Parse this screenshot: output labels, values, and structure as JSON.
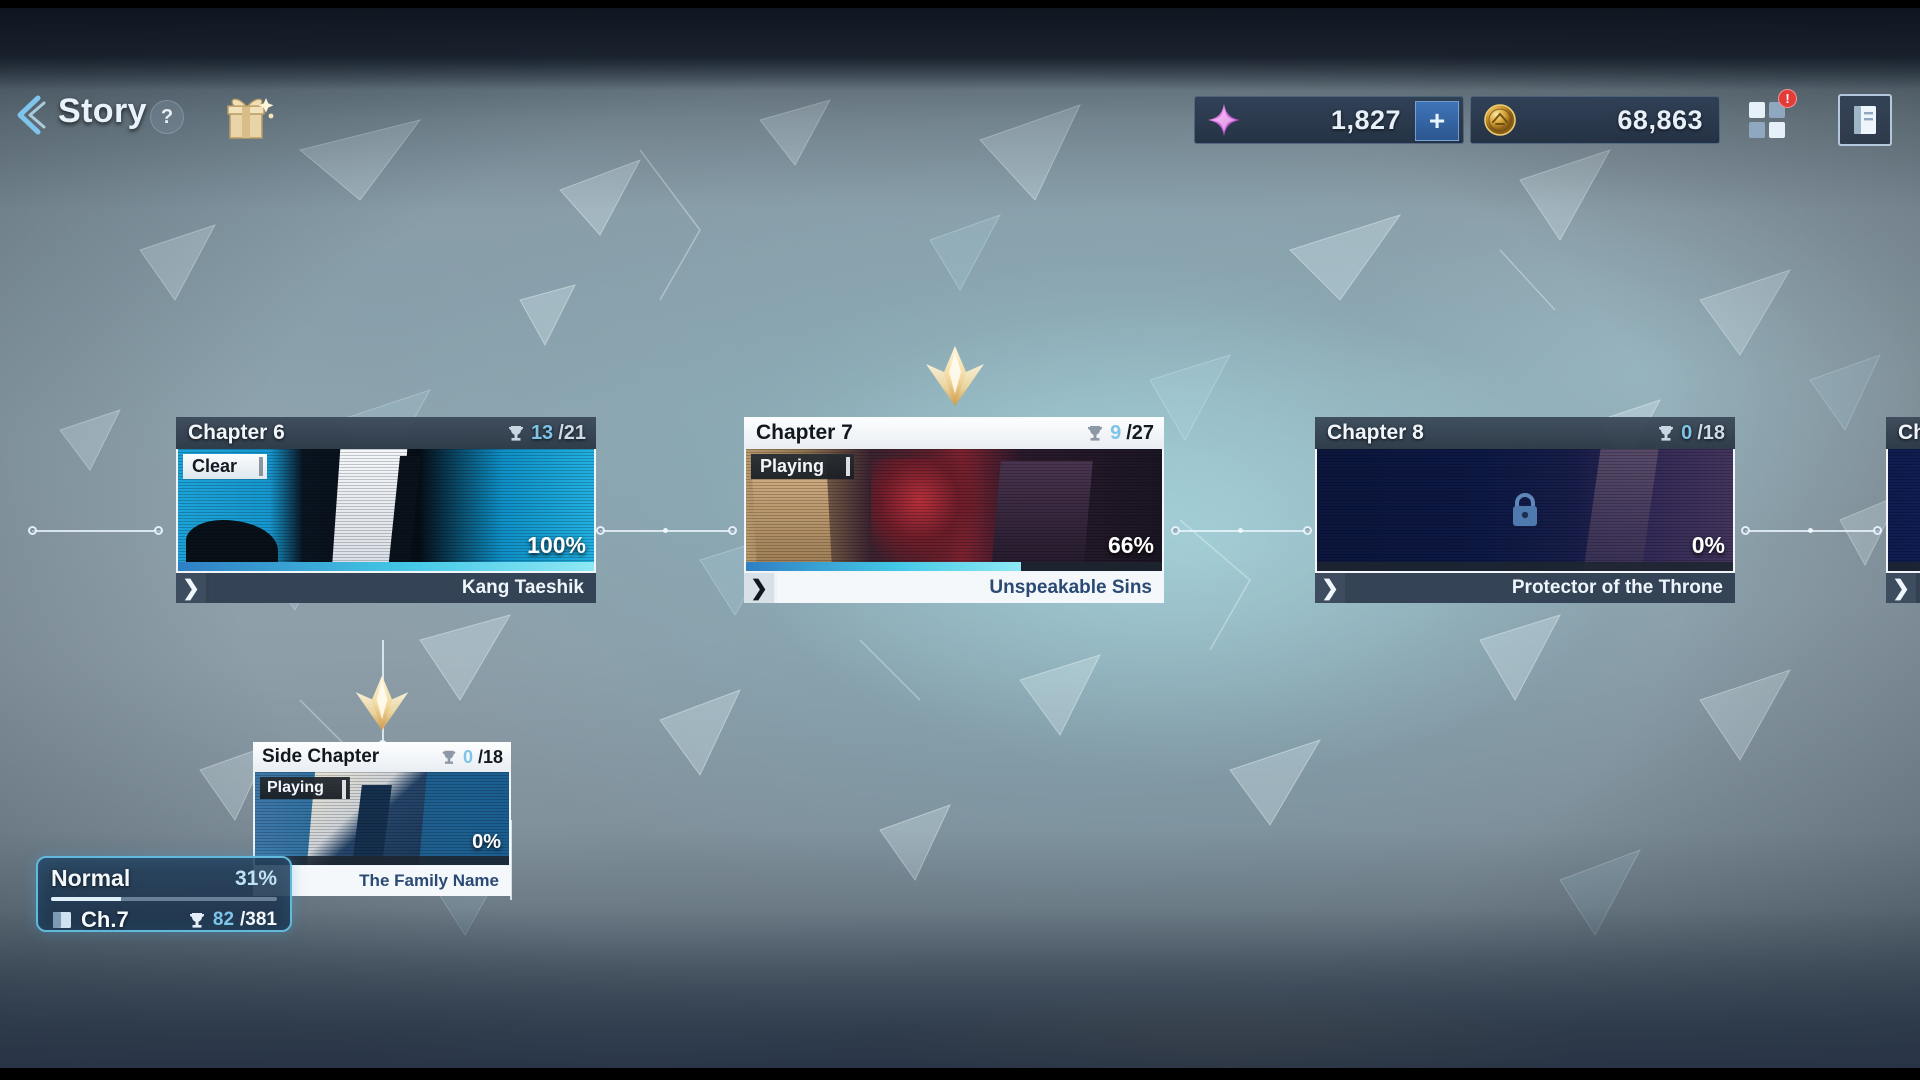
{
  "header": {
    "back_icon": "chevron-left-icon",
    "title": "Story",
    "help_label": "?",
    "gift_icon": "gift-box-icon",
    "menu_icon": "grid-menu-icon",
    "book_icon": "book-icon",
    "notification_count": "!"
  },
  "currency": {
    "gem": {
      "icon": "gem-star-icon",
      "value": "1,827",
      "add_label": "+",
      "color": "#d96ae0"
    },
    "gold": {
      "icon": "gold-coin-icon",
      "value": "68,863",
      "color": "#d8a53a"
    }
  },
  "chapters": [
    {
      "id": "chapter-6",
      "title": "Chapter 6",
      "trophy_current": "13",
      "trophy_total": "/21",
      "status_badge": "Clear",
      "progress_percent": "100%",
      "progress_value": 100,
      "stage_name": "Kang Taeshik",
      "state": "cleared",
      "locked": false
    },
    {
      "id": "chapter-7",
      "title": "Chapter 7",
      "trophy_current": "9",
      "trophy_total": "/27",
      "status_badge": "Playing",
      "progress_percent": "66%",
      "progress_value": 66,
      "stage_name": "Unspeakable Sins",
      "state": "active",
      "locked": false
    },
    {
      "id": "chapter-8",
      "title": "Chapter 8",
      "trophy_current": "0",
      "trophy_total": "/18",
      "status_badge": "",
      "progress_percent": "0%",
      "progress_value": 0,
      "stage_name": "Protector of the Throne",
      "state": "locked",
      "locked": true
    },
    {
      "id": "chapter-9",
      "title": "Ch",
      "trophy_current": "",
      "trophy_total": "",
      "status_badge": "",
      "progress_percent": "",
      "progress_value": 0,
      "stage_name": "",
      "state": "locked",
      "locked": true
    }
  ],
  "side_chapter": {
    "id": "side-chapter",
    "title": "Side Chapter",
    "trophy_current": "0",
    "trophy_total": "/18",
    "status_badge": "Playing",
    "progress_percent": "0%",
    "progress_value": 0,
    "stage_name": "The Family Name",
    "state": "active"
  },
  "hud": {
    "difficulty": "Normal",
    "completion_percent": "31%",
    "completion_value": 31,
    "book_icon": "book-icon",
    "chapter_label": "Ch.7",
    "trophy_icon": "trophy-icon",
    "trophy_current": "82",
    "trophy_total": "/381"
  },
  "colors": {
    "accent_cyan": "#43c8e6",
    "accent_blue": "#3e74b8",
    "gem_pink": "#d96ae0",
    "gold": "#d8a53a",
    "hud_border": "#63b9dc",
    "notification_red": "#e33b38"
  }
}
